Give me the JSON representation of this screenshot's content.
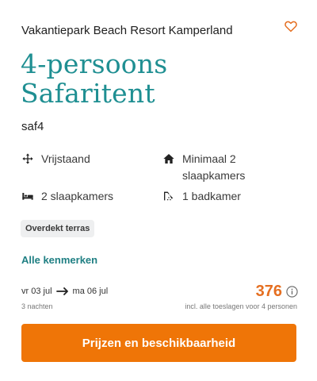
{
  "card": {
    "park_name": "Vakantiepark Beach Resort Kamperland",
    "title": "4-persoons Safaritent",
    "code": "saf4",
    "favorite_icon": "heart-outline-icon",
    "features": [
      {
        "icon": "move-arrows-icon",
        "label": "Vrijstaand"
      },
      {
        "icon": "house-icon",
        "label": "Minimaal 2 slaapkamers"
      },
      {
        "icon": "bed-icon",
        "label": "2 slaapkamers"
      },
      {
        "icon": "shower-icon",
        "label": "1 badkamer"
      }
    ],
    "tag": "Overdekt terras",
    "all_features_link": "Alle kenmerken",
    "stay": {
      "from": "vr 03 jul",
      "to": "ma 06 jul",
      "nights": "3 nachten"
    },
    "price": {
      "amount": "376",
      "note": "incl. alle toeslagen voor 4 personen"
    },
    "cta_label": "Prijzen en beschikbaarheid",
    "colors": {
      "title": "#1f8f92",
      "link": "#1f7f83",
      "accent": "#ef7507",
      "price": "#e56f21"
    }
  }
}
